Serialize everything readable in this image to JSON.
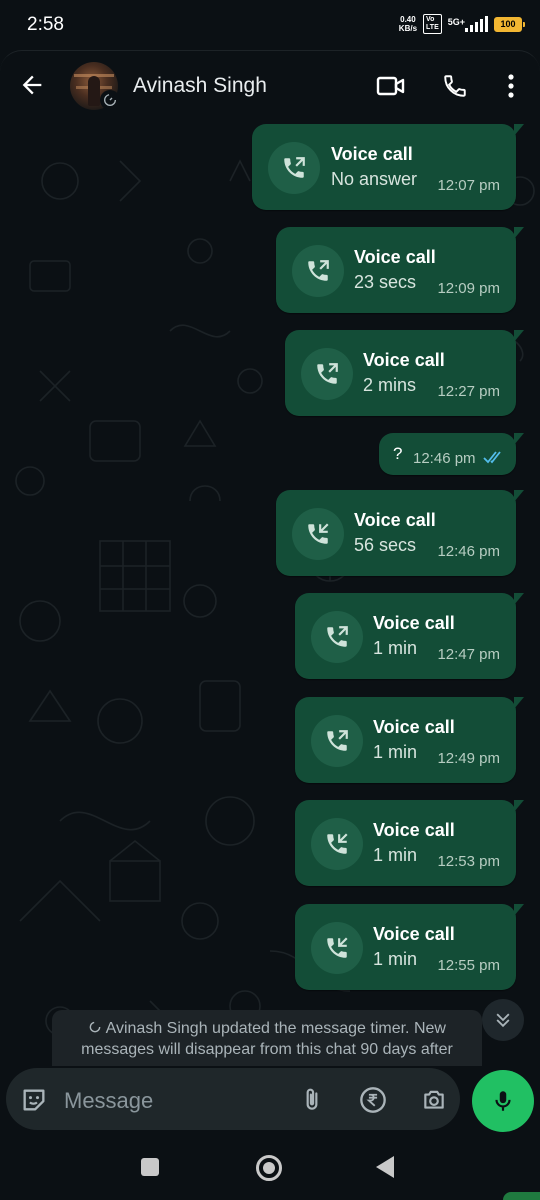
{
  "status_bar": {
    "time": "2:58",
    "speed_value": "0.40",
    "speed_unit": "KB/s",
    "volte": "Vo\nLTE",
    "network": "5G+",
    "battery": "100"
  },
  "header": {
    "contact_name": "Avinash Singh"
  },
  "messages": [
    {
      "title": "Voice call",
      "detail": "No answer",
      "time": "12:07 pm"
    },
    {
      "title": "Voice call",
      "detail": "23 secs",
      "time": "12:09 pm"
    },
    {
      "title": "Voice call",
      "detail": "2 mins",
      "time": "12:27 pm"
    },
    {
      "text": "?",
      "time": "12:46 pm"
    },
    {
      "title": "Voice call",
      "detail": "56 secs",
      "time": "12:46 pm"
    },
    {
      "title": "Voice call",
      "detail": "1 min",
      "time": "12:47 pm"
    },
    {
      "title": "Voice call",
      "detail": "1 min",
      "time": "12:49 pm"
    },
    {
      "title": "Voice call",
      "detail": "1 min",
      "time": "12:53 pm"
    },
    {
      "title": "Voice call",
      "detail": "1 min",
      "time": "12:55 pm"
    }
  ],
  "system_message": {
    "text": "Avinash Singh updated the message timer. New messages will disappear from this chat 90 days after"
  },
  "composer": {
    "placeholder": "Message"
  },
  "colors": {
    "bubble_out": "#134d37",
    "accent_green": "#21c063",
    "read_ticks": "#53bdeb",
    "background": "#0b1014"
  }
}
